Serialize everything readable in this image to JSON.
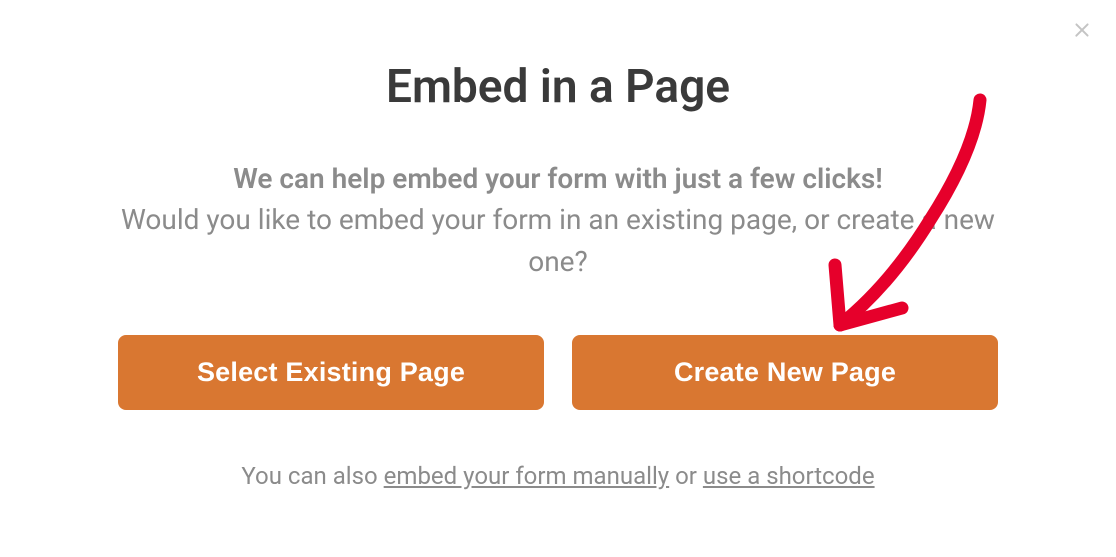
{
  "modal": {
    "title": "Embed in a Page",
    "desc_line1": "We can help embed your form with just a few clicks!",
    "desc_line2": "Would you like to embed your form in an existing page, or create a new one?",
    "buttons": {
      "existing": "Select Existing Page",
      "create": "Create New Page"
    },
    "footer": {
      "prefix": "You can also ",
      "link1": "embed your form manually",
      "middle": " or ",
      "link2": "use a shortcode"
    }
  }
}
